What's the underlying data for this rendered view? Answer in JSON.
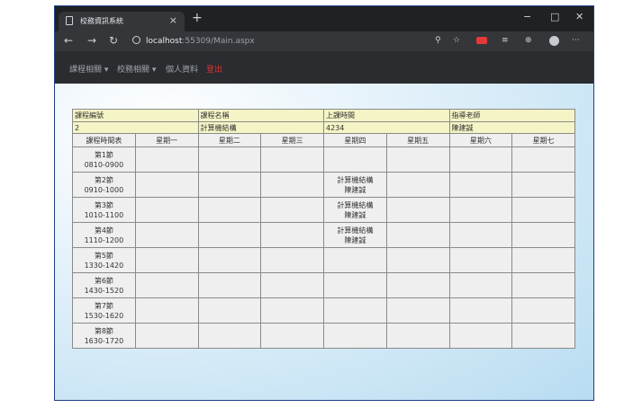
{
  "browser": {
    "tab_title": "校務資訊系統",
    "tab_close": "×",
    "new_tab": "+",
    "minimize": "−",
    "maximize": "□",
    "close": "✕",
    "back": "←",
    "forward": "→",
    "reload": "↻",
    "url_host": "localhost",
    "url_rest": ":55309/Main.aspx"
  },
  "nav": {
    "items": [
      "課程相關 ▾",
      "校務相關 ▾",
      "個人資料",
      "登出"
    ]
  },
  "course_info": {
    "headers": [
      "課程編號",
      "課程名稱",
      "上課時間",
      "指導老師"
    ],
    "values": [
      "2",
      "計算機結構",
      "4234",
      "陳建誠"
    ]
  },
  "schedule": {
    "headers": [
      "課程時間表",
      "星期一",
      "星期二",
      "星期三",
      "星期四",
      "星期五",
      "星期六",
      "星期七"
    ],
    "periods": [
      {
        "name": "第1節",
        "time": "0810-0900",
        "cells": [
          [
            "",
            ""
          ],
          [
            "",
            ""
          ],
          [
            "",
            ""
          ],
          [
            "",
            ""
          ],
          [
            "",
            ""
          ],
          [
            "",
            ""
          ],
          [
            "",
            ""
          ]
        ]
      },
      {
        "name": "第2節",
        "time": "0910-1000",
        "cells": [
          [
            "",
            ""
          ],
          [
            "",
            ""
          ],
          [
            "",
            ""
          ],
          [
            "計算機結構",
            "陳建誠"
          ],
          [
            "",
            ""
          ],
          [
            "",
            ""
          ],
          [
            "",
            ""
          ]
        ]
      },
      {
        "name": "第3節",
        "time": "1010-1100",
        "cells": [
          [
            "",
            ""
          ],
          [
            "",
            ""
          ],
          [
            "",
            ""
          ],
          [
            "計算機結構",
            "陳建誠"
          ],
          [
            "",
            ""
          ],
          [
            "",
            ""
          ],
          [
            "",
            ""
          ]
        ]
      },
      {
        "name": "第4節",
        "time": "1110-1200",
        "cells": [
          [
            "",
            ""
          ],
          [
            "",
            ""
          ],
          [
            "",
            ""
          ],
          [
            "計算機結構",
            "陳建誠"
          ],
          [
            "",
            ""
          ],
          [
            "",
            ""
          ],
          [
            "",
            ""
          ]
        ]
      },
      {
        "name": "第5節",
        "time": "1330-1420",
        "cells": [
          [
            "",
            ""
          ],
          [
            "",
            ""
          ],
          [
            "",
            ""
          ],
          [
            "",
            ""
          ],
          [
            "",
            ""
          ],
          [
            "",
            ""
          ],
          [
            "",
            ""
          ]
        ]
      },
      {
        "name": "第6節",
        "time": "1430-1520",
        "cells": [
          [
            "",
            ""
          ],
          [
            "",
            ""
          ],
          [
            "",
            ""
          ],
          [
            "",
            ""
          ],
          [
            "",
            ""
          ],
          [
            "",
            ""
          ],
          [
            "",
            ""
          ]
        ]
      },
      {
        "name": "第7節",
        "time": "1530-1620",
        "cells": [
          [
            "",
            ""
          ],
          [
            "",
            ""
          ],
          [
            "",
            ""
          ],
          [
            "",
            ""
          ],
          [
            "",
            ""
          ],
          [
            "",
            ""
          ],
          [
            "",
            ""
          ]
        ]
      },
      {
        "name": "第8節",
        "time": "1630-1720",
        "cells": [
          [
            "",
            ""
          ],
          [
            "",
            ""
          ],
          [
            "",
            ""
          ],
          [
            "",
            ""
          ],
          [
            "",
            ""
          ],
          [
            "",
            ""
          ],
          [
            "",
            ""
          ]
        ]
      }
    ]
  }
}
